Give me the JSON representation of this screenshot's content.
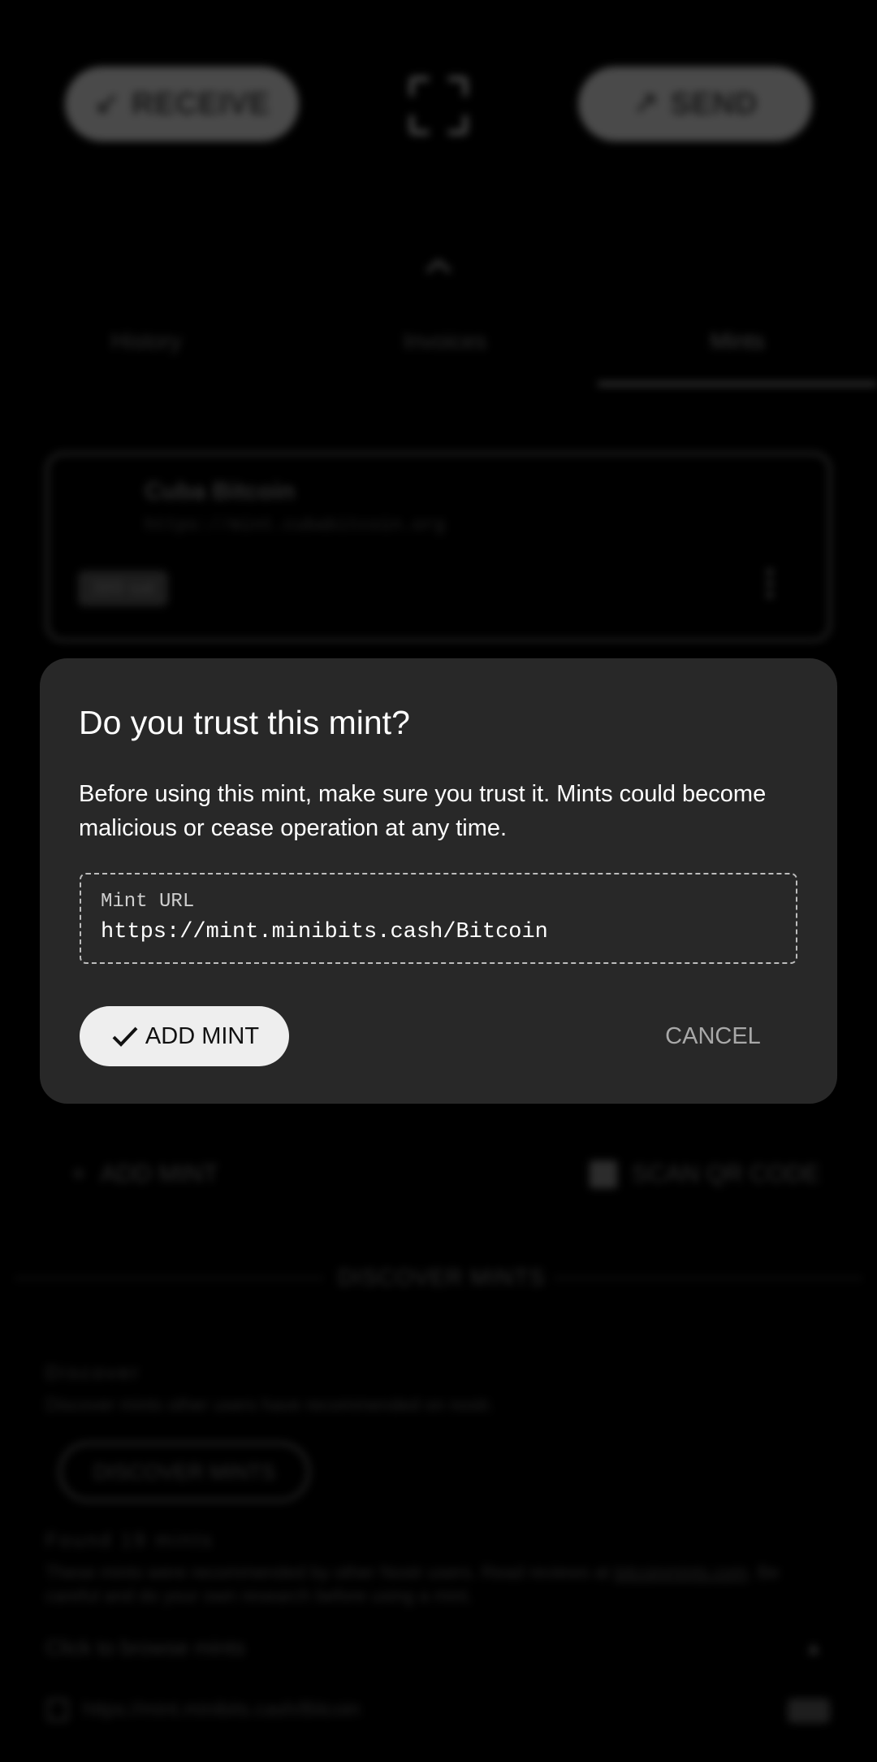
{
  "header": {
    "receive_label": "RECEIVE",
    "send_label": "SEND"
  },
  "tabs": [
    {
      "label": "History"
    },
    {
      "label": "Invoices"
    },
    {
      "label": "Mints"
    }
  ],
  "mint_card": {
    "name": "Cuba Bitcoin",
    "url": "https://mint.cubabitcoin.org",
    "balance": "389 sat"
  },
  "actions": {
    "add_mint_label": "ADD MINT",
    "scan_qr_label": "SCAN QR CODE"
  },
  "discover": {
    "heading": "DISCOVER MINTS",
    "label": "Discover",
    "description": "Discover mints other users have recommended on nostr.",
    "button_label": "DISCOVER MINTS",
    "found_label": "Found 19 mints",
    "found_desc_prefix": "These mints were recommended by other Nostr users. Read reviews at ",
    "found_desc_link": "bitcoinmints.com",
    "found_desc_suffix": ". Be careful and do your own research before using a mint.",
    "browse_label": "Click to browse mints",
    "list_item_url": "https://mint.minibits.cash/Bitcoin"
  },
  "dialog": {
    "title": "Do you trust this mint?",
    "body": "Before using this mint, make sure you trust it. Mints could become malicious or cease operation at any time.",
    "url_label": "Mint URL",
    "url_value": "https://mint.minibits.cash/Bitcoin",
    "confirm_label": "ADD MINT",
    "cancel_label": "CANCEL"
  },
  "colors": {
    "dialog_bg": "#282828",
    "confirm_bg": "#eeeeee",
    "cancel_text": "#a8a8a8"
  }
}
